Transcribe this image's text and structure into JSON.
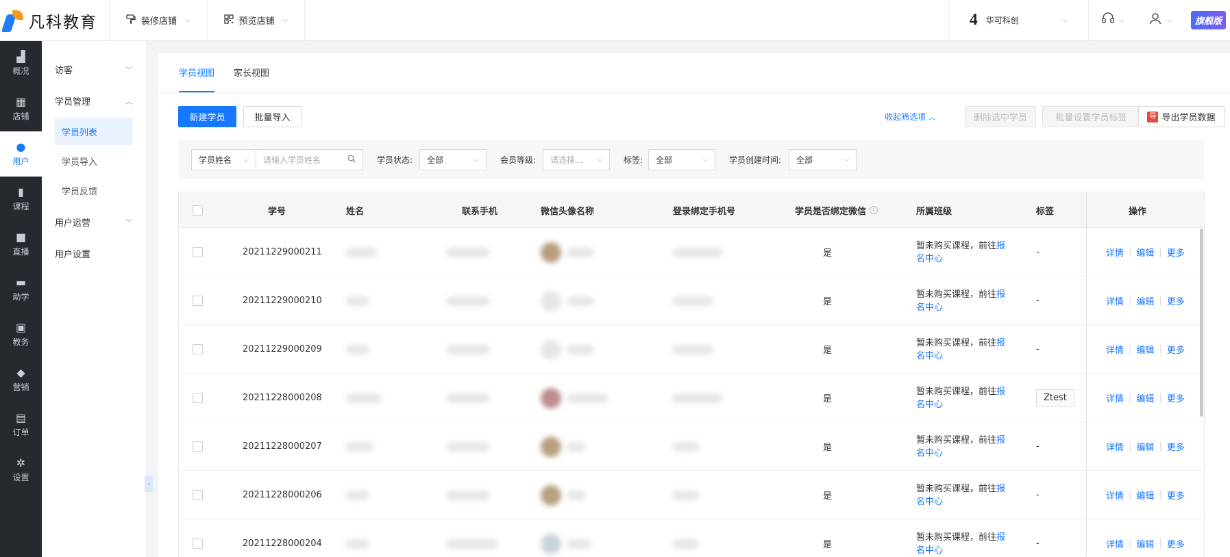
{
  "topbar": {
    "logo_text": "凡科教育",
    "menu": [
      {
        "label": "装修店铺"
      },
      {
        "label": "预览店铺"
      }
    ],
    "org_badge": "4",
    "org_name": "华可科创",
    "vip_label": "旗舰版"
  },
  "rail": [
    {
      "label": "概况",
      "icon": "chart-icon"
    },
    {
      "label": "店铺",
      "icon": "store-icon"
    },
    {
      "label": "用户",
      "icon": "users-icon",
      "active": true
    },
    {
      "label": "课程",
      "icon": "book-icon"
    },
    {
      "label": "直播",
      "icon": "camera-icon"
    },
    {
      "label": "助学",
      "icon": "gamepad-icon"
    },
    {
      "label": "教务",
      "icon": "notebook-icon"
    },
    {
      "label": "营销",
      "icon": "tag-icon"
    },
    {
      "label": "订单",
      "icon": "document-icon"
    },
    {
      "label": "设置",
      "icon": "gear-icon"
    }
  ],
  "submenu": {
    "visitor": "访客",
    "student_mgmt": "学员管理",
    "items": [
      "学员列表",
      "学员导入",
      "学员反馈"
    ],
    "user_ops": "用户运营",
    "user_settings": "用户设置"
  },
  "tabs": [
    "学员视图",
    "家长视图"
  ],
  "toolbar": {
    "new_student": "新建学员",
    "batch_import": "批量导入",
    "collapse_filters": "收起筛选项",
    "delete_selected": "删除选中学员",
    "batch_tag": "批量设置学员标签",
    "export": "导出学员数据"
  },
  "filters": {
    "name_select": "学员姓名",
    "name_placeholder": "请输入学员姓名",
    "status_label": "学员状态:",
    "status_value": "全部",
    "level_label": "会员等级:",
    "level_placeholder": "请选择...",
    "tag_label": "标签:",
    "tag_value": "全部",
    "created_label": "学员创建时间:",
    "created_value": "全部"
  },
  "table": {
    "headers": {
      "id": "学号",
      "name": "姓名",
      "phone": "联系手机",
      "wechat": "微信头像名称",
      "login_phone": "登录绑定手机号",
      "wechat_bound": "学员是否绑定微信",
      "class": "所属班级",
      "tag": "标签",
      "ops": "操作"
    },
    "class_text": "暂未购买课程，前往",
    "class_link": "报名中心",
    "ops": {
      "detail": "详情",
      "edit": "编辑",
      "more": "更多"
    },
    "rows": [
      {
        "id": "20211229000211",
        "bound": "是",
        "tag": "-"
      },
      {
        "id": "20211229000210",
        "bound": "是",
        "tag": "-"
      },
      {
        "id": "20211229000209",
        "bound": "是",
        "tag": "-"
      },
      {
        "id": "20211228000208",
        "bound": "是",
        "tag": "Ztest"
      },
      {
        "id": "20211228000207",
        "bound": "是",
        "tag": "-"
      },
      {
        "id": "20211228000206",
        "bound": "是",
        "tag": "-"
      },
      {
        "id": "20211228000204",
        "bound": "是",
        "tag": "-"
      }
    ]
  },
  "colors": {
    "accent": "#1677ff",
    "rail_bg": "#26292e"
  }
}
